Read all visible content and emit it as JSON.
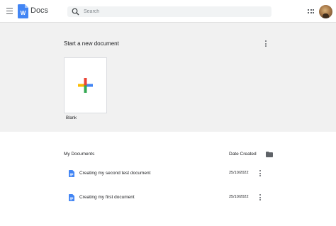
{
  "header": {
    "app_title": "Docs",
    "search_placeholder": "Search"
  },
  "gallery": {
    "title": "Start a new document",
    "blank_label": "Blank"
  },
  "documents": {
    "header_label": "My Documents",
    "date_header": "Date Created",
    "rows": [
      {
        "title": "Creating my second test document",
        "date": "25/10/2022"
      },
      {
        "title": "Creating my first document",
        "date": "25/10/2022"
      }
    ]
  },
  "colors": {
    "docs_blue": "#4285f4",
    "gallery_bg": "#f1f1f1",
    "plus_red": "#ea4335",
    "plus_yellow": "#fbbc04",
    "plus_green": "#34a853",
    "plus_blue": "#4285f4"
  },
  "icons": [
    "hamburger-menu-icon",
    "docs-logo-icon",
    "search-icon",
    "apps-grid-icon",
    "more-vert-icon",
    "folder-icon",
    "document-icon"
  ]
}
